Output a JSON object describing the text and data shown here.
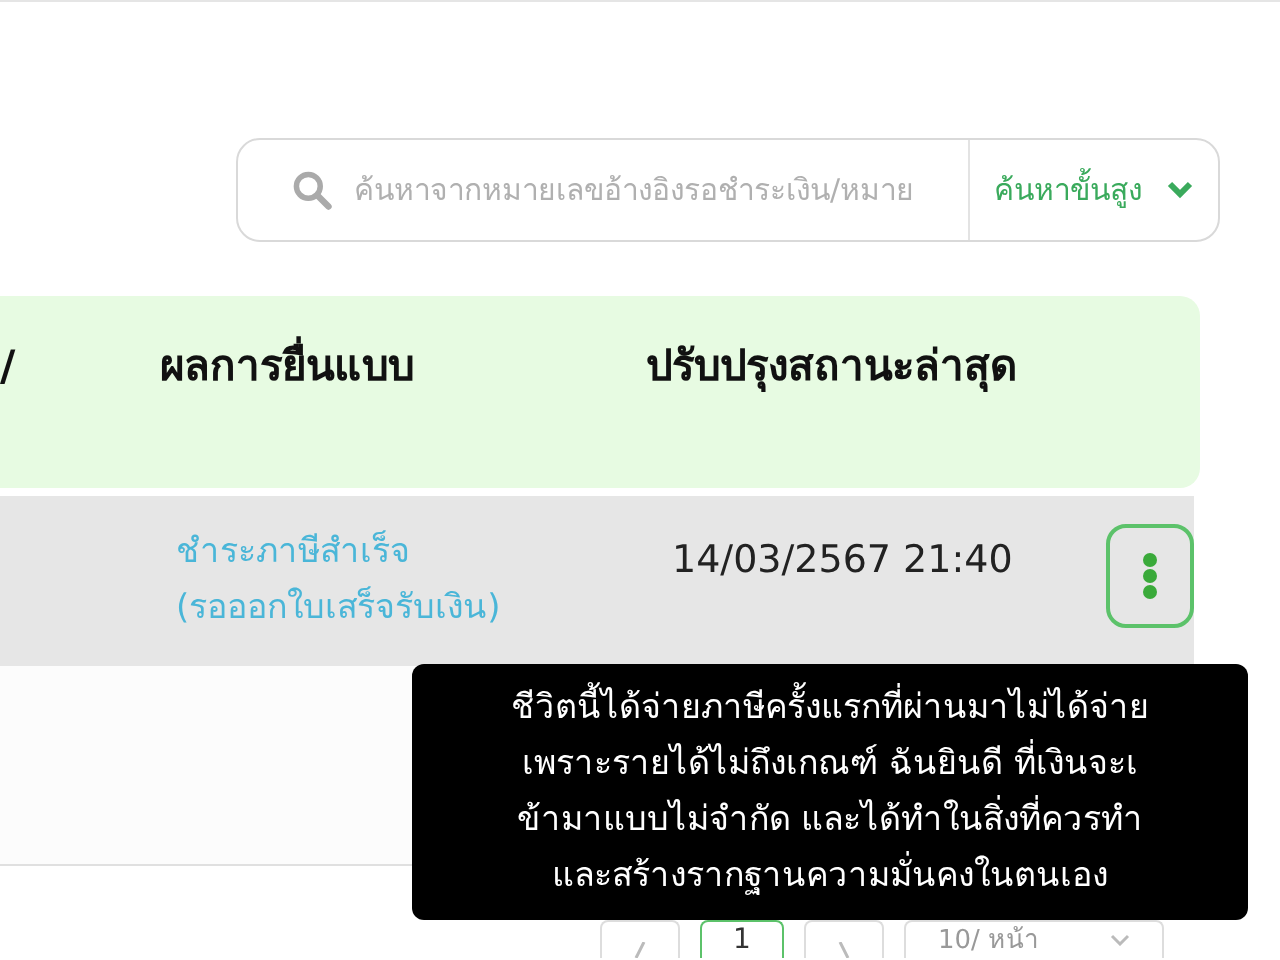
{
  "search": {
    "placeholder": "ค้นหาจากหมายเลขอ้างอิงรอชำระเงิน/หมาย",
    "advanced_label": "ค้นหาขั้นสูง"
  },
  "table": {
    "columns": [
      "/",
      "ผลการยื่นแบบ",
      "ปรับปรุงสถานะล่าสุด"
    ],
    "rows": [
      {
        "status_lines": [
          "ชำระภาษีสำเร็จ",
          "(รอออกใบเสร็จรับเงิน)"
        ],
        "updated": "14/03/2567 21:40"
      }
    ]
  },
  "pagination": {
    "pages": [
      {
        "label": "1",
        "selected": true
      }
    ],
    "page_size": "10/ หน้า"
  },
  "caption": {
    "lines": [
      "ชีวิตนี้ได้จ่ายภาษีครั้งแรกที่ผ่านมาไม่ได้จ่าย",
      "เพราะรายได้ไม่ถึงเกณฑ์  ฉันยินดี ที่เงินจะเ",
      "ข้ามาแบบไม่จำกัด และได้ทำในสิ่งที่ควรทำ",
      "และสร้างรากฐานความมั่นคงในตนเอง"
    ]
  }
}
